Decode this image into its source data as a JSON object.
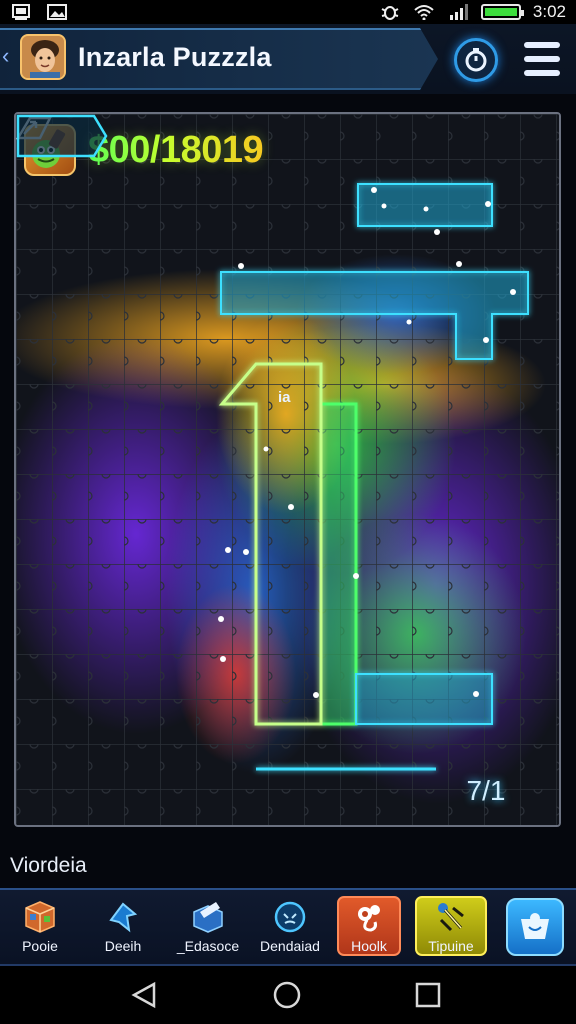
{
  "status_bar": {
    "time": "3:02",
    "battery_level": 1.0,
    "icons": [
      "gallery-icon",
      "image-icon",
      "bug-icon",
      "wifi-icon",
      "signal-icon",
      "battery-icon"
    ]
  },
  "header": {
    "title": "Inzarla Puzzzla",
    "back_icon": "chevron-left-icon",
    "avatar_icon": "player-avatar",
    "timer_icon": "timer-icon",
    "menu_icon": "hamburger-icon"
  },
  "board": {
    "score": "$00/18019",
    "level_badge": "7/1",
    "score_icon": "character-gem-icon",
    "fullscreen_icon": "fullscreen-icon",
    "overlay_label": "ia",
    "colors": {
      "cyan_glow": "#3de0ff",
      "green_glow": "#4dff6a",
      "orange_glow": "#ffb020",
      "purple_glow": "#8a3cff"
    }
  },
  "section_label": "Viordeia",
  "toolbar": {
    "items": [
      {
        "label": "Pooie",
        "icon": "puzzle-box-icon"
      },
      {
        "label": "Deeih",
        "icon": "design-arrow-icon"
      },
      {
        "label": "_Edasoce",
        "icon": "edit-box-icon"
      },
      {
        "label": "Dendaiad",
        "icon": "download-circle-icon"
      },
      {
        "label": "Hoolk",
        "icon": "hook-icon"
      },
      {
        "label": "Tipuine",
        "icon": "tips-tool-icon"
      },
      {
        "label": "",
        "icon": "user-cart-icon"
      }
    ]
  },
  "nav_bar": {
    "icons": [
      "back-triangle-icon",
      "home-circle-icon",
      "recent-square-icon"
    ]
  }
}
